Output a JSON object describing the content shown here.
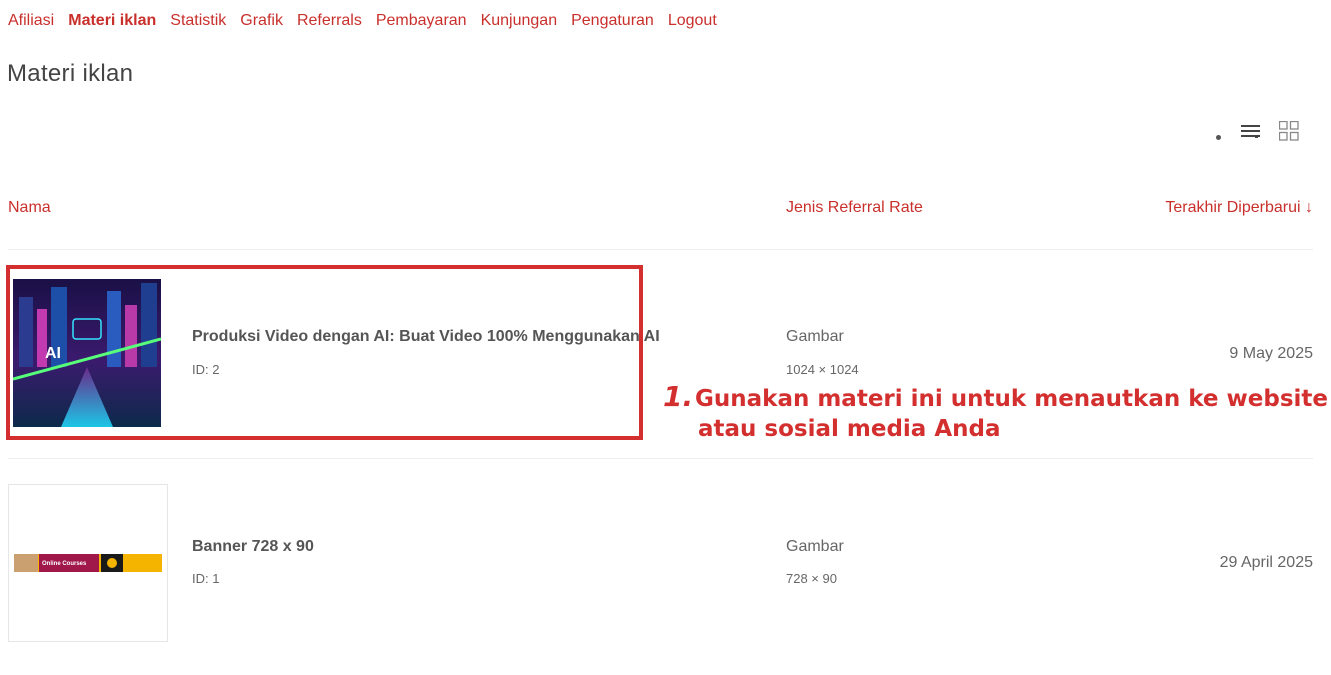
{
  "nav": {
    "items": [
      "Afiliasi",
      "Materi iklan",
      "Statistik",
      "Grafik",
      "Referrals",
      "Pembayaran",
      "Kunjungan",
      "Pengaturan",
      "Logout"
    ],
    "active": "Materi iklan"
  },
  "page_title": "Materi iklan",
  "view_toggle": {
    "list_icon": "list-icon",
    "grid_icon": "grid-icon"
  },
  "table": {
    "headers": {
      "name": "Nama",
      "type": "Jenis Referral Rate",
      "updated": "Terakhir Diperbarui ↓"
    },
    "rows": [
      {
        "name": "Produksi Video dengan AI: Buat Video 100% Menggunakan AI",
        "id": "ID: 2",
        "type": "Gambar",
        "dims": "1024 × 1024",
        "date": "9 May 2025",
        "thumb_text": "AI"
      },
      {
        "name": "Banner 728 x 90",
        "id": "ID: 1",
        "type": "Gambar",
        "dims": "728 × 90",
        "date": "29 April 2025",
        "thumb_text": "Online Courses"
      }
    ]
  },
  "annotation": {
    "number": "1.",
    "line1": "Gunakan materi ini untuk menautkan ke website",
    "line2": "atau sosial media Anda"
  },
  "colors": {
    "accent": "#c9302c",
    "annotation": "#d32f2f"
  }
}
